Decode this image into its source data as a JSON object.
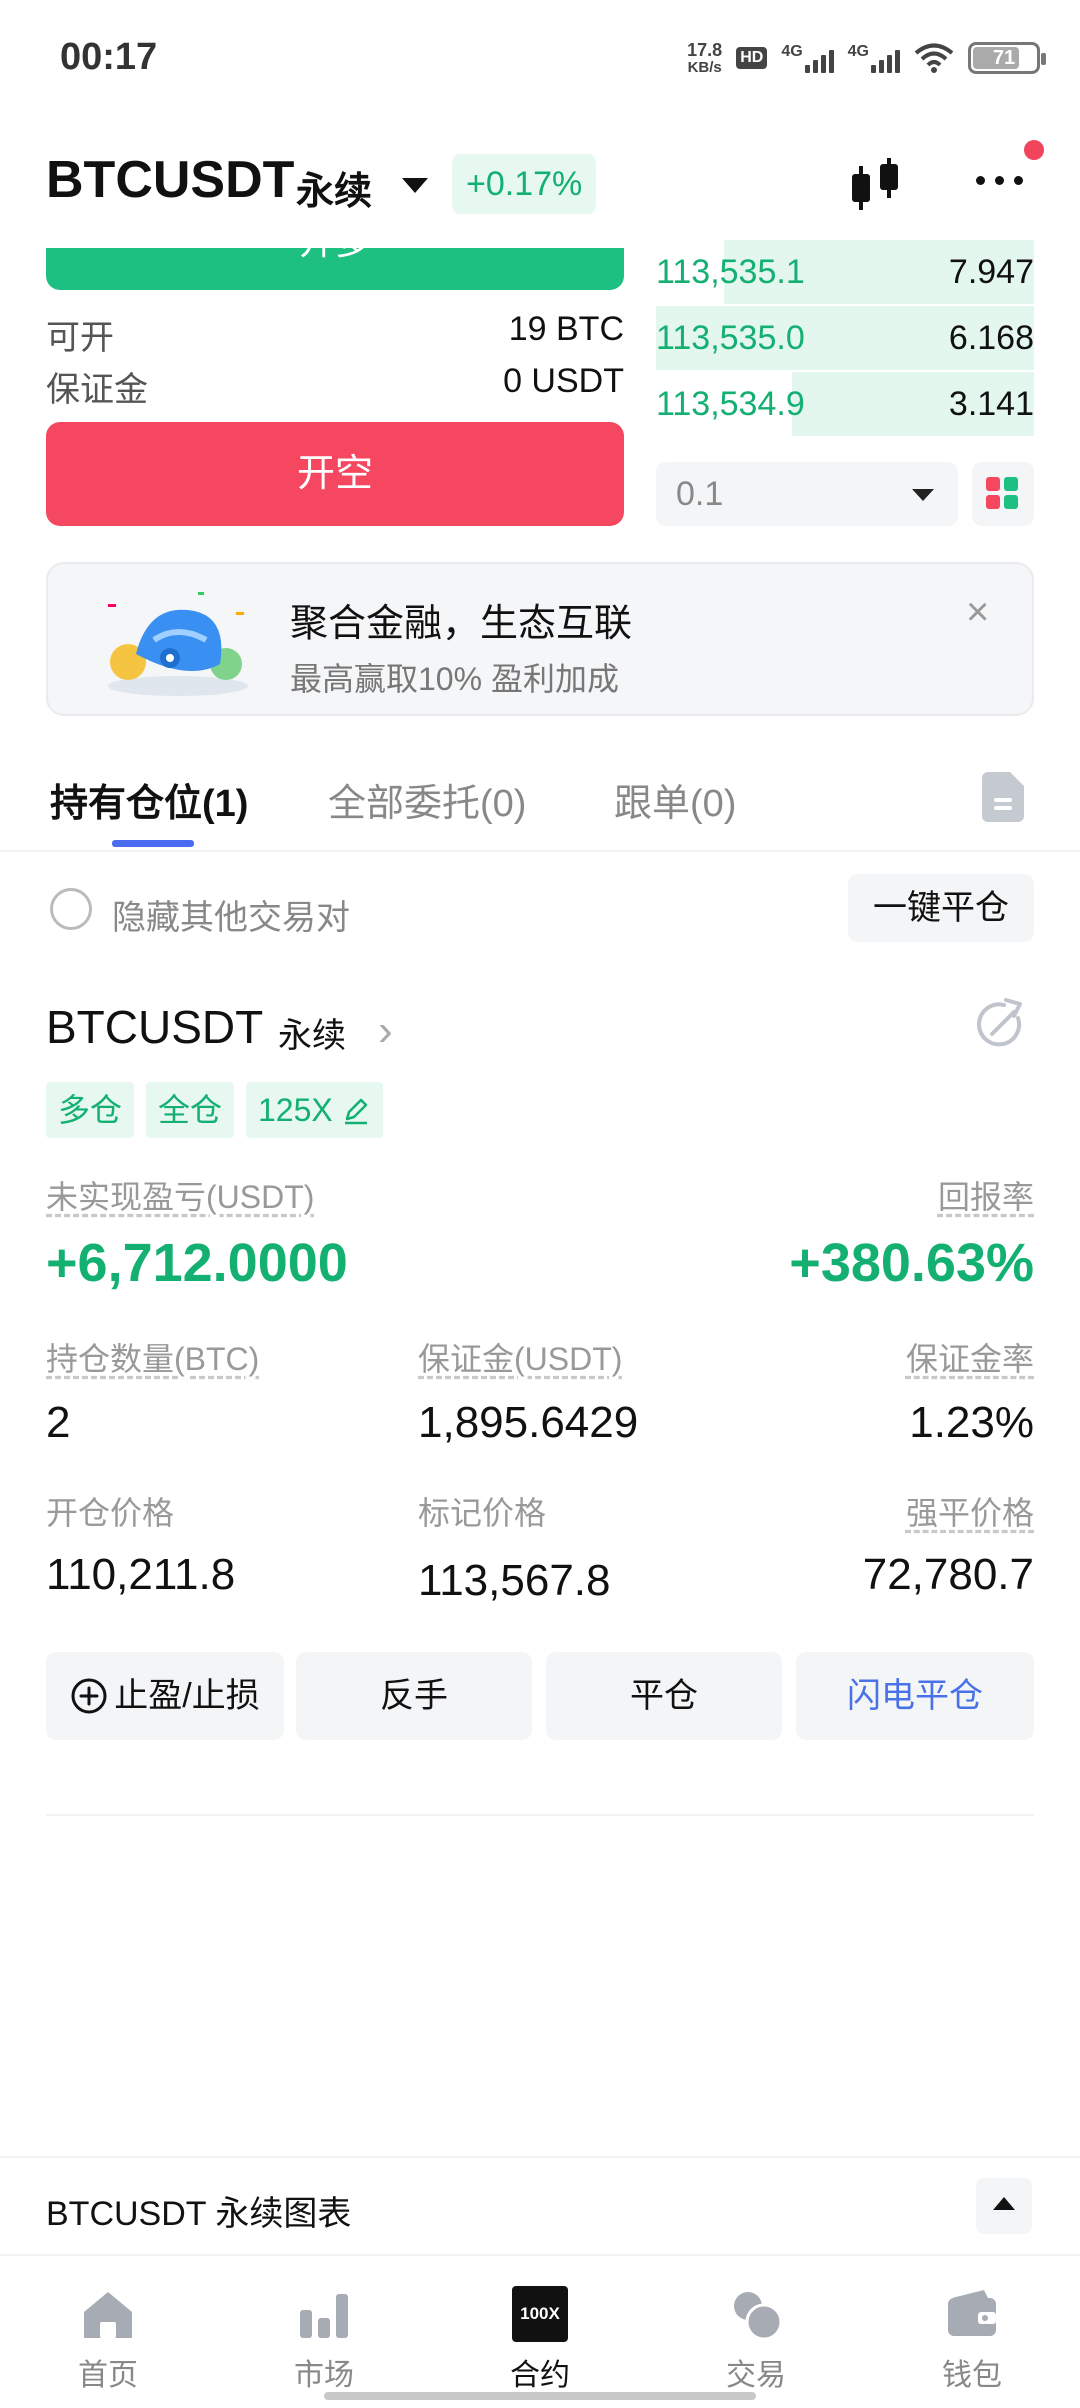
{
  "status_bar": {
    "time": "00:17",
    "net_speed_value": "17.8",
    "net_speed_unit": "KB/s",
    "hd_label": "HD",
    "signal1": "4G",
    "signal2": "4G",
    "battery": "71"
  },
  "header": {
    "pair": "BTCUSDT",
    "contract_type": "永续",
    "change": "+0.17%",
    "icons": [
      "candlestick-icon",
      "more-icon"
    ]
  },
  "trade_panel": {
    "long_button_label": "开多",
    "available_label": "可开",
    "available_value": "19 BTC",
    "margin_label": "保证金",
    "margin_value": "0 USDT",
    "short_button_label": "开空",
    "order_book": [
      {
        "price": "113,535.1",
        "qty": "7.947",
        "depth": 0.82
      },
      {
        "price": "113,535.0",
        "qty": "6.168",
        "depth": 1.0
      },
      {
        "price": "113,534.9",
        "qty": "3.141",
        "depth": 0.64
      }
    ],
    "quantity_select": "0.1"
  },
  "banner": {
    "title": "聚合金融，生态互联",
    "subtitle": "最高赢取10% 盈利加成",
    "close": "×"
  },
  "tabs": {
    "positions": "持有仓位(1)",
    "orders": "全部委托(0)",
    "copy": "跟单(0)"
  },
  "filter": {
    "hide_others": "隐藏其他交易对",
    "close_all": "一键平仓"
  },
  "position": {
    "pair": "BTCUSDT",
    "contract_type": "永续",
    "tags": [
      "多仓",
      "全仓",
      "125X"
    ],
    "unrealized_pnl_label": "未实现盈亏(USDT)",
    "unrealized_pnl": "+6,712.0000",
    "roe_label": "回报率",
    "roe": "+380.63%",
    "size_label": "持仓数量(BTC)",
    "size": "2",
    "margin_label": "保证金(USDT)",
    "margin": "1,895.6429",
    "margin_ratio_label": "保证金率",
    "margin_ratio": "1.23%",
    "entry_label": "开仓价格",
    "entry": "110,211.8",
    "mark_label": "标记价格",
    "mark": "113,567.8",
    "liq_label": "强平价格",
    "liq": "72,780.7",
    "actions": {
      "tpsl": "止盈/止损",
      "reverse": "反手",
      "close": "平仓",
      "flash_close": "闪电平仓"
    }
  },
  "chart_bar": {
    "title": "BTCUSDT 永续图表"
  },
  "nav": {
    "items": [
      {
        "label": "首页",
        "icon": "home-icon"
      },
      {
        "label": "市场",
        "icon": "market-icon"
      },
      {
        "label": "合约",
        "icon": "futures-icon",
        "badge": "100X"
      },
      {
        "label": "交易",
        "icon": "trade-icon"
      },
      {
        "label": "钱包",
        "icon": "wallet-icon"
      }
    ],
    "active": "合约"
  },
  "colors": {
    "green": "#13b072",
    "red": "#f5475f",
    "blue": "#4a72e8",
    "accent_underline": "#4a6cf0"
  }
}
